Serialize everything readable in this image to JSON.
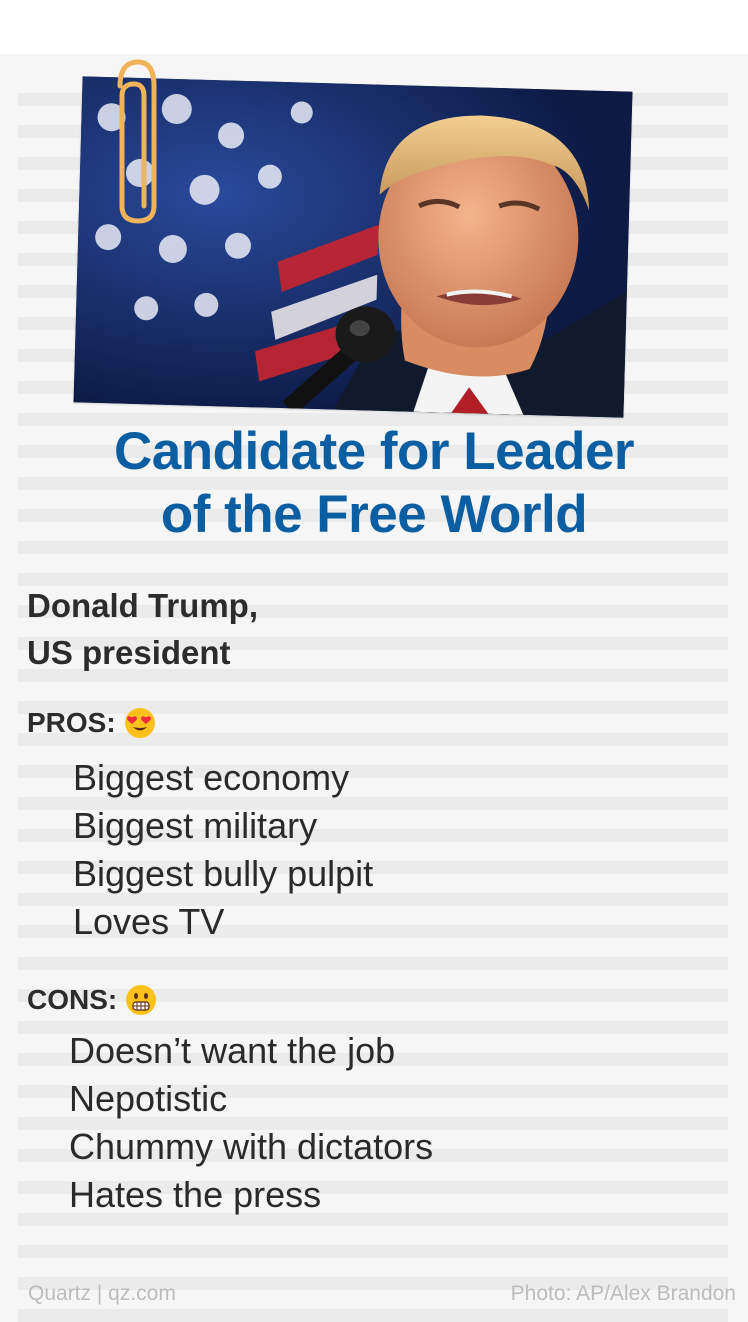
{
  "title_line1": "Candidate for Leader",
  "title_line2": "of the Free World",
  "name_line1": "Donald Trump,",
  "name_line2": "US president",
  "pros": {
    "label": "PROS:",
    "emoji": "heart-eyes-emoji",
    "items": [
      "Biggest economy",
      "Biggest military",
      "Biggest bully pulpit",
      "Loves TV"
    ]
  },
  "cons": {
    "label": "CONS:",
    "emoji": "grimacing-emoji",
    "items": [
      "Doesn’t want the job",
      "Nepotistic",
      "Chummy with dictators",
      "Hates the press"
    ]
  },
  "footer": {
    "source": "Quartz | qz.com",
    "credit": "Photo: AP/Alex Brandon"
  },
  "colors": {
    "title": "#0a5ea1",
    "text": "#2c2c2c",
    "footer": "#bcbcbc",
    "stripe": "#ebebeb",
    "clip": "#f0b35a"
  }
}
